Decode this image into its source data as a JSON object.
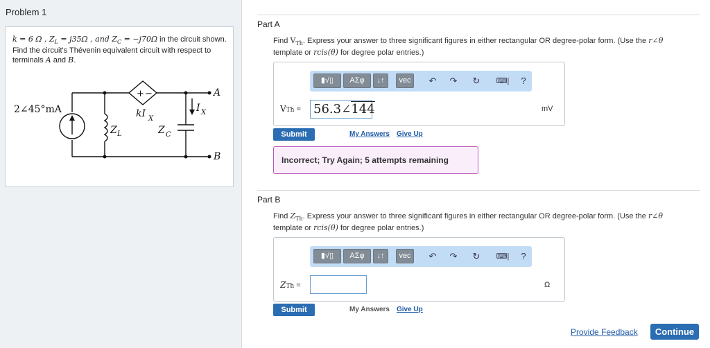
{
  "problem": {
    "title": "Problem 1",
    "statement_k": "k = 6 Ω , Z",
    "statement_zl": "L",
    "statement_zl_val": " = j35Ω , and Z",
    "statement_zc": "C",
    "statement_zc_val": " = −j70Ω",
    "statement_rest": " in the circuit shown.  Find the circuit's Thévenin equivalent circuit with respect to terminals ",
    "terminal_a": "A",
    "and": " and ",
    "terminal_b": "B",
    "period": "."
  },
  "circuit": {
    "source_label": "2∠45°mA",
    "zl_label": "Z",
    "zl_sub": "L",
    "dep_source_label": "kI",
    "dep_source_sub": "X",
    "zc_label": "Z",
    "zc_sub": "C",
    "ix_label": "I",
    "ix_sub": "X",
    "terminal_a": "A",
    "terminal_b": "B",
    "plus": "+",
    "minus": "−"
  },
  "part_a": {
    "title": "Part A",
    "prompt_start": "Find ",
    "prompt_var": "V",
    "prompt_var_sub": "Th",
    "prompt_mid": ".  Express your answer to three significant figures in either rectangular OR degree-polar form.  (Use the ",
    "prompt_math": "r∠θ",
    "prompt_line2_start": "template or ",
    "prompt_cis": "rcis(θ)",
    "prompt_end": " for degree polar entries.)",
    "var_label": "V",
    "var_sub": "Th",
    "equals": " =",
    "answer_value": "56.3",
    "answer_angle": "144",
    "unit": "mV",
    "submit": "Submit",
    "my_answers": "My Answers",
    "give_up": "Give Up",
    "feedback": "Incorrect; Try Again; 5 attempts remaining"
  },
  "part_b": {
    "title": "Part B",
    "prompt_start": "Find ",
    "prompt_var": "Z",
    "prompt_var_sub": "Th",
    "prompt_mid": ".  Express your answer to three significant figures in either rectangular OR degree-polar form.  (Use the ",
    "prompt_math": "r∠θ",
    "prompt_line2_start": "template or ",
    "prompt_cis": "rcis(θ)",
    "prompt_end": " for degree polar entries.)",
    "var_label": "Z",
    "var_sub": "Th",
    "equals": " =",
    "answer_value": "",
    "unit": "Ω",
    "submit": "Submit",
    "my_answers": "My Answers",
    "give_up": "Give Up"
  },
  "toolbar": {
    "templates": "▮√▯",
    "greek": "ΑΣφ",
    "arrows": "↓↑",
    "vec": "vec",
    "undo_icon": "undo-icon",
    "redo_icon": "redo-icon",
    "reset_icon": "reset-icon",
    "keyboard_icon": "keyboard-icon",
    "help": "?"
  },
  "footer": {
    "provide_feedback": "Provide Feedback",
    "continue": "Continue"
  }
}
